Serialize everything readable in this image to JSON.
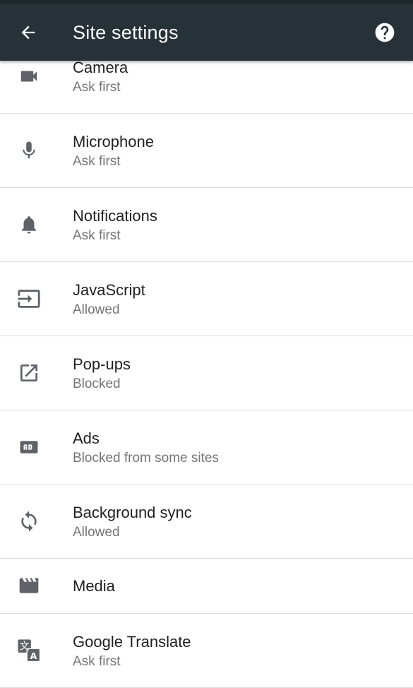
{
  "toolbar": {
    "title": "Site settings",
    "back_icon": "arrow-back-icon",
    "help_icon": "help-icon"
  },
  "settings": [
    {
      "label": "Camera",
      "status": "Ask first",
      "icon": "camera-icon"
    },
    {
      "label": "Microphone",
      "status": "Ask first",
      "icon": "microphone-icon"
    },
    {
      "label": "Notifications",
      "status": "Ask first",
      "icon": "bell-icon"
    },
    {
      "label": "JavaScript",
      "status": "Allowed",
      "icon": "javascript-icon"
    },
    {
      "label": "Pop-ups",
      "status": "Blocked",
      "icon": "open-in-new-icon"
    },
    {
      "label": "Ads",
      "status": "Blocked from some sites",
      "icon": "ads-icon"
    },
    {
      "label": "Background sync",
      "status": "Allowed",
      "icon": "sync-icon"
    },
    {
      "label": "Media",
      "icon": "media-icon"
    },
    {
      "label": "Google Translate",
      "status": "Ask first",
      "icon": "translate-icon"
    }
  ],
  "colors": {
    "toolbar_bg": "#263238",
    "icon": "#5f6368",
    "primary_text": "#212121",
    "secondary_text": "#757575"
  }
}
